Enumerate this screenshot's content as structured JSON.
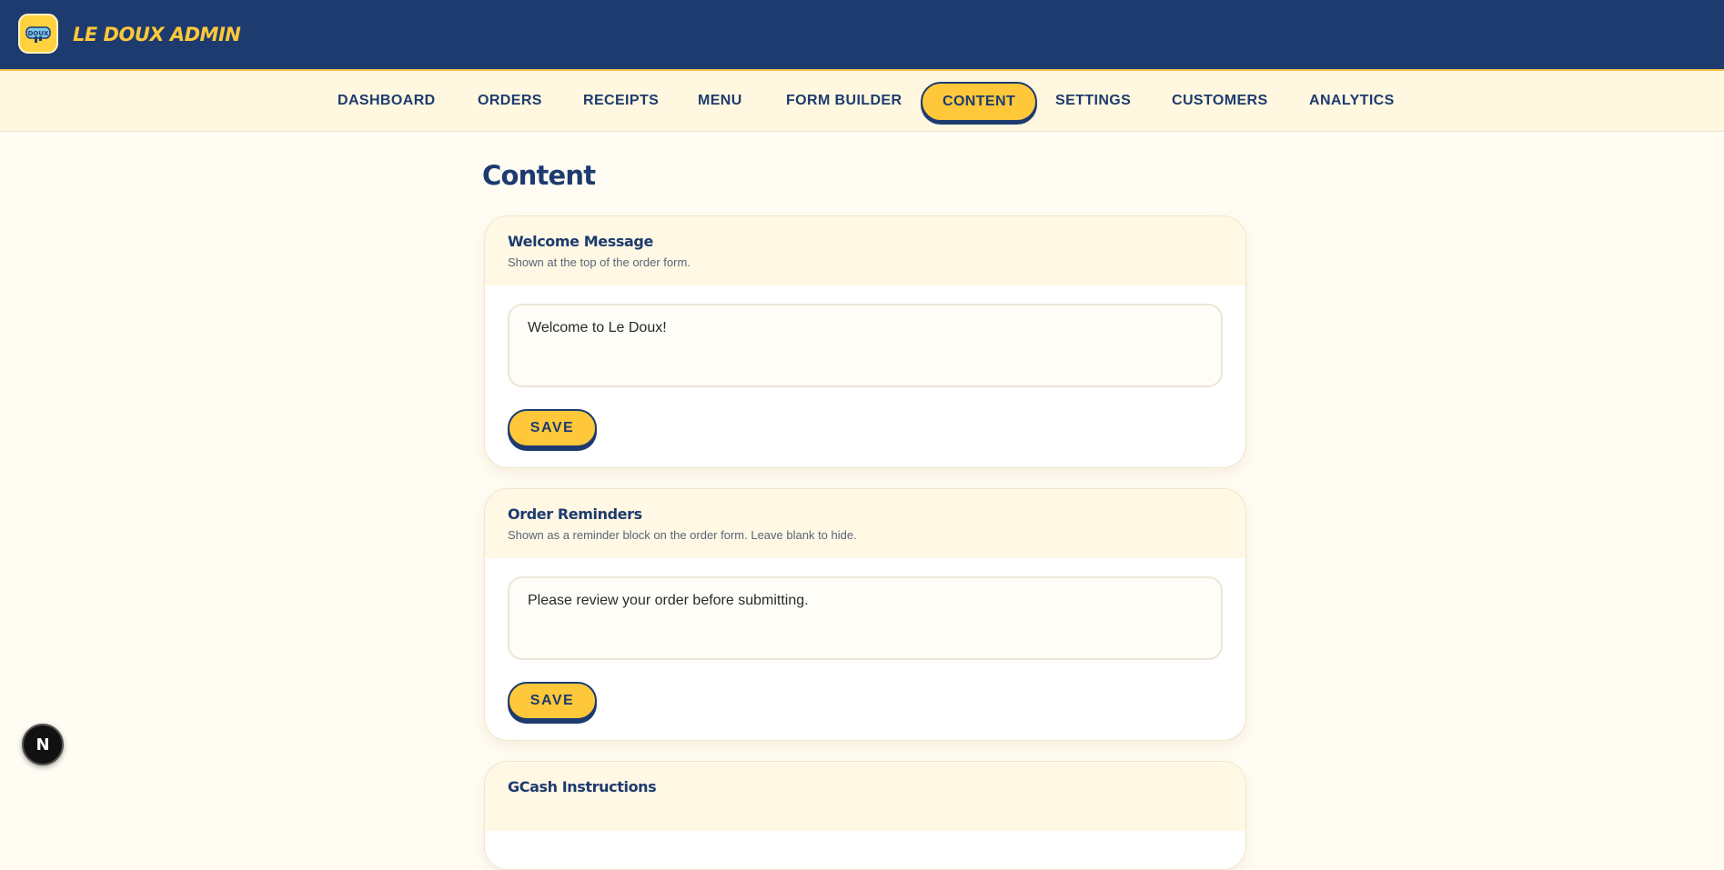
{
  "header": {
    "brand": "LE DOUX ADMIN",
    "logo_icon": "ledoux-logo-icon"
  },
  "nav": {
    "items": [
      {
        "label": "DASHBOARD"
      },
      {
        "label": "ORDERS"
      },
      {
        "label": "RECEIPTS"
      },
      {
        "label": "MENU"
      },
      {
        "label": "FORM BUILDER"
      },
      {
        "label": "CONTENT",
        "active": true
      },
      {
        "label": "SETTINGS"
      },
      {
        "label": "CUSTOMERS"
      },
      {
        "label": "ANALYTICS"
      }
    ]
  },
  "page": {
    "title": "Content"
  },
  "sections": [
    {
      "title": "Welcome Message",
      "subtitle": "Shown at the top of the order form.",
      "value": "Welcome to Le Doux!",
      "save_label": "SAVE"
    },
    {
      "title": "Order Reminders",
      "subtitle": "Shown as a reminder block on the order form. Leave blank to hide.",
      "value": "Please review your order before submitting.",
      "save_label": "SAVE"
    },
    {
      "title": "GCash Instructions"
    }
  ],
  "overlay": {
    "badge_letter": "N",
    "badge_icon": "nextjs-devtools-icon"
  },
  "colors": {
    "primary": "#1d3b6f",
    "accent": "#ffc83a",
    "background": "#fffcf3",
    "card_header": "#fff8e4"
  }
}
